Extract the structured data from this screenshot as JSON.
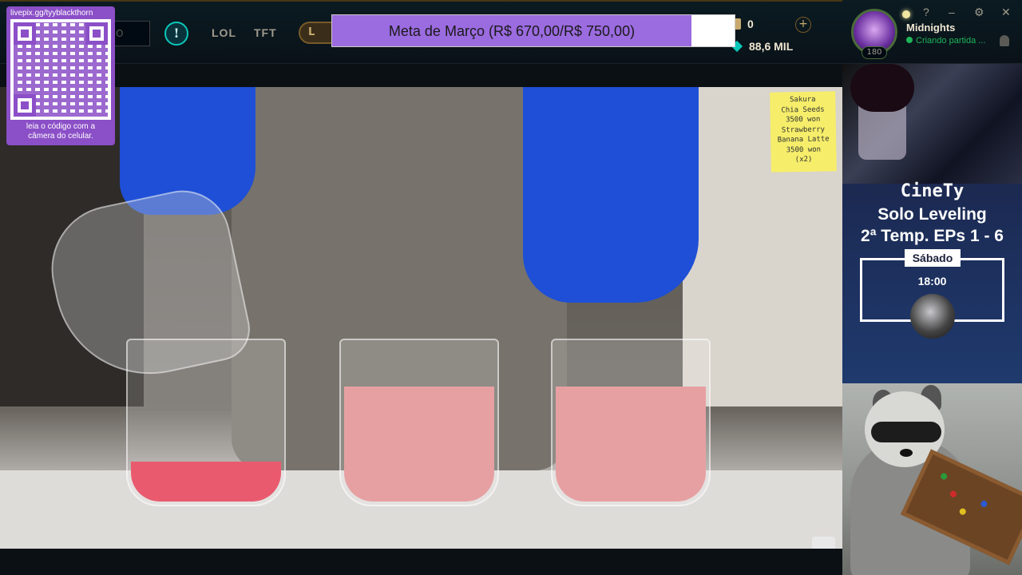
{
  "topbar": {
    "search_placeholder": "O",
    "info_label": "!",
    "nav": [
      {
        "label": "LOL"
      },
      {
        "label": "TFT"
      }
    ],
    "play_label": "L",
    "rp_amount": "0",
    "be_amount": "88,6 MIL",
    "plus_label": "+",
    "level": "180",
    "summoner_name": "Midnights",
    "status_text": "Criando partida ...",
    "window_controls": [
      "?",
      "–",
      "⚙",
      "✕"
    ]
  },
  "goal": {
    "label": "Meta de Março (R$ 670,00/R$ 750,00)",
    "progress": 0.893
  },
  "qr": {
    "url": "livepix.gg/tyyblackthorn",
    "caption_line1": "leia o código com a",
    "caption_line2": "câmera do celular."
  },
  "video": {
    "sticky_note": [
      "Sakura",
      "Chia Seeds",
      "3500 won",
      "Strawberry",
      "Banana Latte",
      "3500 won",
      "(x2)"
    ]
  },
  "promo": {
    "brand": "CineTy",
    "line1": "Solo Leveling",
    "line2": "2ª Temp. EPs 1 - 6",
    "day": "Sábado",
    "time": "18:00"
  },
  "colors": {
    "goal_fill": "#9b6be0",
    "qr_panel": "#8b4fc7",
    "status_green": "#1eb45a",
    "lol_gold": "#c8aa6e"
  },
  "icons": [
    "info-icon",
    "rp-icon",
    "blue-essence-icon",
    "plus-icon",
    "bell-icon",
    "help-icon",
    "minimize-icon",
    "settings-icon",
    "close-icon"
  ]
}
